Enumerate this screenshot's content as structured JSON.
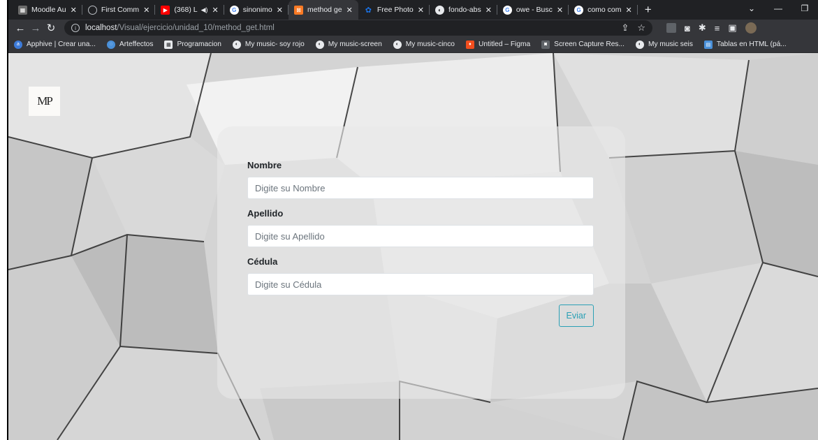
{
  "browser": {
    "tabs": [
      {
        "label": "Moodle Au",
        "icon": "moodle-icon",
        "color": "#6b6b6b"
      },
      {
        "label": "First Comm",
        "icon": "github-icon",
        "color": "#202124"
      },
      {
        "label": "(368) L",
        "icon": "youtube-icon",
        "color": "#ff0000"
      },
      {
        "label": "sinonimo",
        "icon": "google-icon",
        "color": "#4285f4"
      },
      {
        "label": "method ge",
        "icon": "xampp-icon",
        "color": "#fb7a24",
        "active": true
      },
      {
        "label": "Free Photo",
        "icon": "photo-icon",
        "color": "#1a73e8"
      },
      {
        "label": "fondo-abs",
        "icon": "globe-icon",
        "color": "#5f6368"
      },
      {
        "label": "owe - Busc",
        "icon": "google-icon",
        "color": "#4285f4"
      },
      {
        "label": "como com",
        "icon": "google-icon",
        "color": "#4285f4"
      }
    ],
    "address": {
      "host": "localhost",
      "path": "/Visual/ejercicio/unidad_10/method_get.html"
    },
    "bookmarks": [
      {
        "label": "Apphive | Crear una...",
        "icon": "apphive-icon",
        "color": "#3d7bd9"
      },
      {
        "label": "Arteffectos",
        "icon": "chat-icon",
        "color": "#4a90d9"
      },
      {
        "label": "Programacion",
        "icon": "grid-icon",
        "color": "#2d2d2d"
      },
      {
        "label": "My music- soy rojo",
        "icon": "globe-icon",
        "color": "#5f6368"
      },
      {
        "label": "My music-screen",
        "icon": "globe-icon",
        "color": "#5f6368"
      },
      {
        "label": "My music-cinco",
        "icon": "globe-icon",
        "color": "#5f6368"
      },
      {
        "label": "Untitled – Figma",
        "icon": "figma-icon",
        "color": "#f24e1e"
      },
      {
        "label": "Screen Capture Res...",
        "icon": "camera-icon",
        "color": "#5f6368"
      },
      {
        "label": "My music seis",
        "icon": "globe-icon",
        "color": "#5f6368"
      },
      {
        "label": "Tablas en HTML (pá...",
        "icon": "doc-icon",
        "color": "#4a90d9"
      }
    ]
  },
  "page": {
    "logo_text": "MP",
    "form": {
      "nombre_label": "Nombre",
      "nombre_placeholder": "Digite su Nombre",
      "apellido_label": "Apellido",
      "apellido_placeholder": "Digite su Apellido",
      "cedula_label": "Cédula",
      "cedula_placeholder": "Digite su Cédula",
      "submit_label": "Eviar"
    }
  }
}
